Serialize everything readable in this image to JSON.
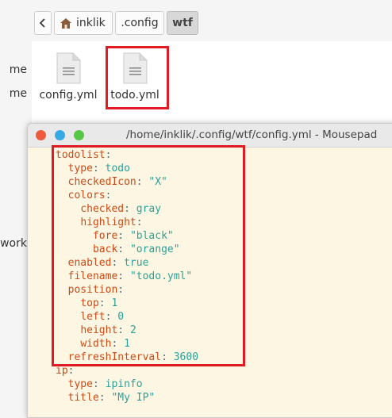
{
  "file_manager": {
    "sidebar_fragments": [
      "me",
      "me",
      "work"
    ],
    "breadcrumbs": {
      "home": "inklik",
      "config": ".config",
      "wtf": "wtf"
    },
    "files": [
      {
        "name": "config.yml",
        "icon": "text-file-icon"
      },
      {
        "name": "todo.yml",
        "icon": "text-file-icon"
      }
    ]
  },
  "editor": {
    "title": "/home/inklik/.config/wtf/config.yml - Mousepad",
    "lines": [
      {
        "indent": 0,
        "key": "todolist",
        "value": ""
      },
      {
        "indent": 1,
        "key": "type",
        "value": "todo"
      },
      {
        "indent": 1,
        "key": "checkedIcon",
        "value": "\"X\""
      },
      {
        "indent": 1,
        "key": "colors",
        "value": ""
      },
      {
        "indent": 2,
        "key": "checked",
        "value": "gray"
      },
      {
        "indent": 2,
        "key": "highlight",
        "value": ""
      },
      {
        "indent": 3,
        "key": "fore",
        "value": "\"black\""
      },
      {
        "indent": 3,
        "key": "back",
        "value": "\"orange\""
      },
      {
        "indent": 1,
        "key": "enabled",
        "value": "true"
      },
      {
        "indent": 1,
        "key": "filename",
        "value": "\"todo.yml\""
      },
      {
        "indent": 1,
        "key": "position",
        "value": ""
      },
      {
        "indent": 2,
        "key": "top",
        "value": "1"
      },
      {
        "indent": 2,
        "key": "left",
        "value": "0"
      },
      {
        "indent": 2,
        "key": "height",
        "value": "2"
      },
      {
        "indent": 2,
        "key": "width",
        "value": "1"
      },
      {
        "indent": 1,
        "key": "refreshInterval",
        "value": "3600"
      },
      {
        "indent": 0,
        "key": "ip",
        "value": ""
      },
      {
        "indent": 1,
        "key": "type",
        "value": "ipinfo"
      },
      {
        "indent": 1,
        "key": "title",
        "value": "\"My IP\""
      }
    ]
  },
  "colors": {
    "highlight_box": "#e01b24",
    "yaml_key": "#cb4b16",
    "yaml_value": "#2aa198",
    "editor_bg": "#fdf6e3"
  }
}
